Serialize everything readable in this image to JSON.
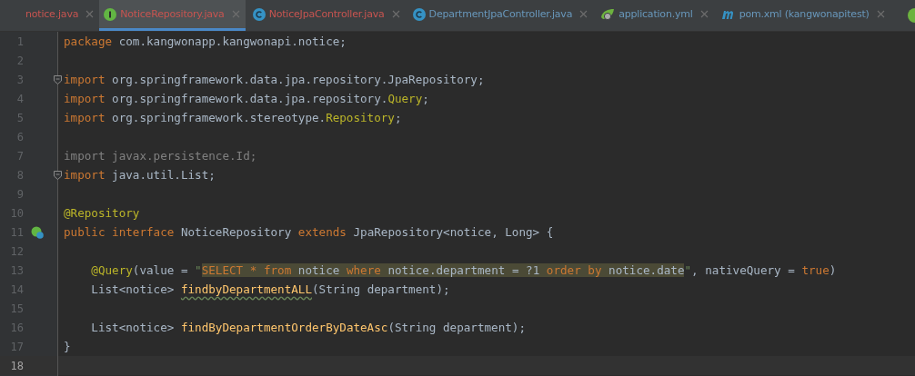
{
  "tabs": [
    {
      "label": "notice.java",
      "kind": "plain",
      "color": "#c75450",
      "selected": false
    },
    {
      "label": "NoticeRepository.java",
      "kind": "interface",
      "color": "#c75450",
      "selected": true
    },
    {
      "label": "NoticeJpaController.java",
      "kind": "class",
      "color": "#c75450",
      "selected": false
    },
    {
      "label": "DepartmentJpaController.java",
      "kind": "class",
      "color": "#6897bb",
      "selected": false
    },
    {
      "label": "application.yml",
      "kind": "spring",
      "color": "#6897bb",
      "selected": false
    },
    {
      "label": "pom.xml (kangwonapitest)",
      "kind": "maven",
      "color": "#6897bb",
      "selected": false
    }
  ],
  "editor": {
    "lines": [
      {
        "number": "1",
        "fold": false,
        "gutter_icon": false,
        "current": false,
        "segments": [
          {
            "text": "package ",
            "kind": "keyword"
          },
          {
            "text": "com.kangwonapp.kangwonapi.notice;",
            "kind": "plain"
          }
        ]
      },
      {
        "number": "2",
        "fold": false,
        "gutter_icon": false,
        "current": false
      },
      {
        "number": "3",
        "fold": true,
        "gutter_icon": false,
        "current": false,
        "segments": [
          {
            "text": "import ",
            "kind": "keyword"
          },
          {
            "text": "org.springframework.data.jpa.repository.JpaRepository;",
            "kind": "plain"
          }
        ]
      },
      {
        "number": "4",
        "fold": false,
        "gutter_icon": false,
        "current": false,
        "segments": [
          {
            "text": "import ",
            "kind": "keyword"
          },
          {
            "text": "org.springframework.data.jpa.repository.",
            "kind": "plain"
          },
          {
            "text": "Query",
            "kind": "annotation"
          },
          {
            "text": ";",
            "kind": "plain"
          }
        ]
      },
      {
        "number": "5",
        "fold": false,
        "gutter_icon": false,
        "current": false,
        "segments": [
          {
            "text": "import ",
            "kind": "keyword"
          },
          {
            "text": "org.springframework.stereotype.",
            "kind": "plain"
          },
          {
            "text": "Repository",
            "kind": "annotation"
          },
          {
            "text": ";",
            "kind": "plain"
          }
        ]
      },
      {
        "number": "6",
        "fold": false,
        "gutter_icon": false,
        "current": false
      },
      {
        "number": "7",
        "fold": false,
        "gutter_icon": false,
        "current": false,
        "segments": [
          {
            "text": "import javax.persistence.Id;",
            "kind": "unused"
          }
        ]
      },
      {
        "number": "8",
        "fold": true,
        "gutter_icon": false,
        "current": false,
        "segments": [
          {
            "text": "import ",
            "kind": "keyword"
          },
          {
            "text": "java.util.List;",
            "kind": "plain"
          }
        ]
      },
      {
        "number": "9",
        "fold": false,
        "gutter_icon": false,
        "current": false
      },
      {
        "number": "10",
        "fold": false,
        "gutter_icon": false,
        "current": false,
        "segments": [
          {
            "text": "@Repository",
            "kind": "annotation"
          }
        ]
      },
      {
        "number": "11",
        "fold": false,
        "gutter_icon": true,
        "current": false,
        "segments": [
          {
            "text": "public interface ",
            "kind": "keyword"
          },
          {
            "text": "NoticeRepository ",
            "kind": "plain"
          },
          {
            "text": "extends ",
            "kind": "keyword"
          },
          {
            "text": "JpaRepository<notice, Long> {",
            "kind": "plain"
          }
        ]
      },
      {
        "number": "12",
        "fold": false,
        "gutter_icon": false,
        "current": false
      },
      {
        "number": "13",
        "fold": false,
        "gutter_icon": false,
        "current": false,
        "segments": [
          {
            "text": "    @Query",
            "kind": "annotation"
          },
          {
            "text": "(value = ",
            "kind": "plain"
          },
          {
            "text": "\"",
            "kind": "string"
          },
          {
            "text": "SELECT * from ",
            "kind": "sql-keyword"
          },
          {
            "text": "notice ",
            "kind": "sql-name"
          },
          {
            "text": "where ",
            "kind": "sql-keyword"
          },
          {
            "text": "notice.department ",
            "kind": "sql-name"
          },
          {
            "text": "= ?1 ",
            "kind": "sql-plain"
          },
          {
            "text": "order by ",
            "kind": "sql-keyword"
          },
          {
            "text": "notice.date",
            "kind": "sql-name"
          },
          {
            "text": "\"",
            "kind": "string"
          },
          {
            "text": ", nativeQuery = ",
            "kind": "plain"
          },
          {
            "text": "true",
            "kind": "keyword"
          },
          {
            "text": ")",
            "kind": "plain"
          }
        ]
      },
      {
        "number": "14",
        "fold": false,
        "gutter_icon": false,
        "current": false,
        "segments": [
          {
            "text": "    List<notice> ",
            "kind": "plain"
          },
          {
            "text": "findbyDepartmentALL",
            "kind": "method-typo"
          },
          {
            "text": "(String department);",
            "kind": "plain"
          }
        ]
      },
      {
        "number": "15",
        "fold": false,
        "gutter_icon": false,
        "current": false
      },
      {
        "number": "16",
        "fold": false,
        "gutter_icon": false,
        "current": false,
        "segments": [
          {
            "text": "    List<notice> ",
            "kind": "plain"
          },
          {
            "text": "findByDepartmentOrderByDateAsc",
            "kind": "method"
          },
          {
            "text": "(String department);",
            "kind": "plain"
          }
        ]
      },
      {
        "number": "17",
        "fold": false,
        "gutter_icon": false,
        "current": false,
        "segments": [
          {
            "text": "}",
            "kind": "plain"
          }
        ]
      },
      {
        "number": "18",
        "fold": false,
        "gutter_icon": false,
        "current": true
      }
    ]
  }
}
